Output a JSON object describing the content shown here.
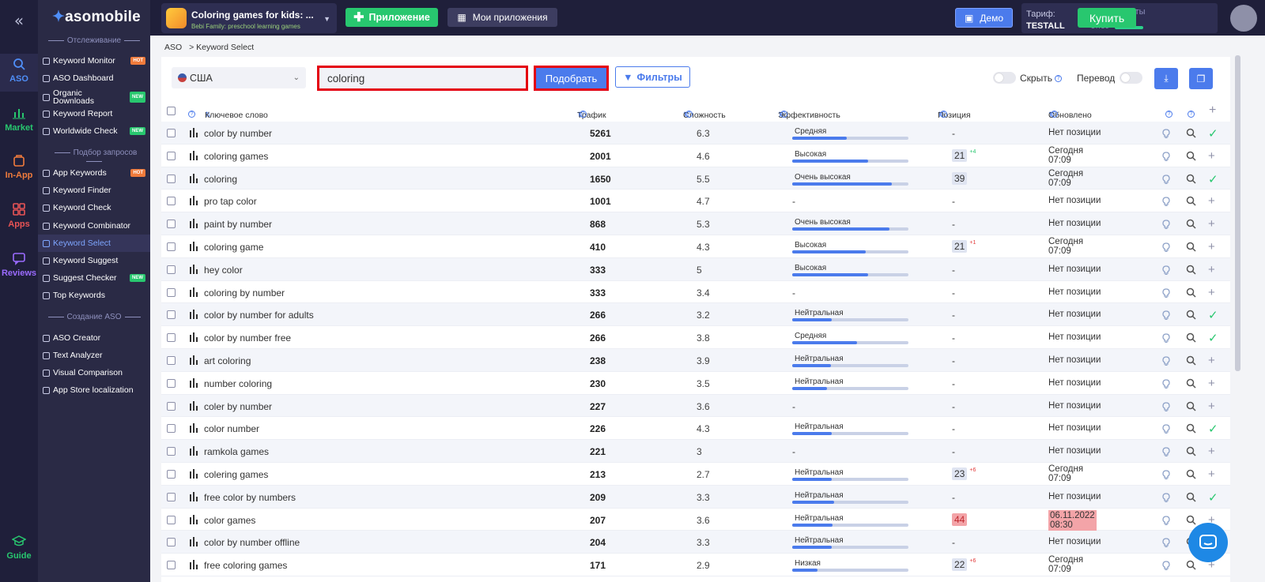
{
  "rail": {
    "items": [
      {
        "label": "ASO",
        "color": "#4f8ef7"
      },
      {
        "label": "Market",
        "color": "#28c76f"
      },
      {
        "label": "In-App",
        "color": "#f07b3c"
      },
      {
        "label": "Apps",
        "color": "#ea5455"
      },
      {
        "label": "Reviews",
        "color": "#9b6bff"
      }
    ],
    "guide": "Guide"
  },
  "brand": {
    "name": "asomobile"
  },
  "sidebar": {
    "sections": [
      "Отслеживание",
      "Подбор запросов",
      "Создание ASO"
    ],
    "items": [
      {
        "label": "Keyword Monitor",
        "tag": "HOT"
      },
      {
        "label": "ASO Dashboard",
        "tag": ""
      },
      {
        "label": "Organic Downloads",
        "tag": "NEW"
      },
      {
        "label": "Keyword Report",
        "tag": ""
      },
      {
        "label": "Worldwide Check",
        "tag": "NEW"
      },
      {
        "label": "App Keywords",
        "tag": "HOT"
      },
      {
        "label": "Keyword Finder",
        "tag": ""
      },
      {
        "label": "Keyword Check",
        "tag": ""
      },
      {
        "label": "Keyword Combinator",
        "tag": ""
      },
      {
        "label": "Keyword Select",
        "tag": ""
      },
      {
        "label": "Keyword Suggest",
        "tag": ""
      },
      {
        "label": "Suggest Checker",
        "tag": "NEW"
      },
      {
        "label": "Top Keywords",
        "tag": ""
      },
      {
        "label": "ASO Creator",
        "tag": ""
      },
      {
        "label": "Text Analyzer",
        "tag": ""
      },
      {
        "label": "Visual Comparison",
        "tag": ""
      },
      {
        "label": "App Store localization",
        "tag": ""
      }
    ]
  },
  "topbar": {
    "app_title": "Coloring games for kids: ...",
    "app_subtitle": "Bebi Family: preschool learning games",
    "add_app": "Приложение",
    "my_apps": "Мои приложения",
    "demo": "Демо",
    "tariff_label": "Тариф:",
    "tariff_name": "TESTALL",
    "tools_label": "Инструменты",
    "tools_count": "57/56",
    "buy": "Купить"
  },
  "breadcrumb": {
    "root": "ASO",
    "current": "> Keyword Select"
  },
  "controls": {
    "country": "США",
    "search_value": "coloring",
    "pick_button": "Подобрать",
    "filters_button": "Фильтры",
    "hide_label": "Скрыть",
    "translate_label": "Перевод"
  },
  "table": {
    "headers": {
      "keyword": "Ключевое слово",
      "traffic": "Трафик",
      "difficulty": "Сложность",
      "efficiency": "Эффективность",
      "position": "Позиция",
      "updated": "Обновлено"
    },
    "rows": [
      {
        "keyword": "color by number",
        "traffic": "5261",
        "difficulty": "6.3",
        "eff_label": "Средняя",
        "eff_level": 0.47,
        "position": "-",
        "pos_change": "",
        "pos_dir": "",
        "pos_red": false,
        "updated": [
          "Нет позиции"
        ],
        "upd_red": false,
        "last": "check"
      },
      {
        "keyword": "coloring games",
        "traffic": "2001",
        "difficulty": "4.6",
        "eff_label": "Высокая",
        "eff_level": 0.65,
        "position": "21",
        "pos_change": "+4",
        "pos_dir": "up",
        "pos_red": false,
        "updated": [
          "Сегодня",
          "07:09"
        ],
        "upd_red": false,
        "last": "plus"
      },
      {
        "keyword": "coloring",
        "traffic": "1650",
        "difficulty": "5.5",
        "eff_label": "Очень высокая",
        "eff_level": 0.86,
        "position": "39",
        "pos_change": "",
        "pos_dir": "",
        "pos_red": false,
        "updated": [
          "Сегодня",
          "07:09"
        ],
        "upd_red": false,
        "last": "check"
      },
      {
        "keyword": "pro tap color",
        "traffic": "1001",
        "difficulty": "4.7",
        "eff_label": "-",
        "eff_level": null,
        "position": "-",
        "pos_change": "",
        "pos_dir": "",
        "pos_red": false,
        "updated": [
          "Нет позиции"
        ],
        "upd_red": false,
        "last": "plus"
      },
      {
        "keyword": "paint by number",
        "traffic": "868",
        "difficulty": "5.3",
        "eff_label": "Очень высокая",
        "eff_level": 0.84,
        "position": "-",
        "pos_change": "",
        "pos_dir": "",
        "pos_red": false,
        "updated": [
          "Нет позиции"
        ],
        "upd_red": false,
        "last": "plus"
      },
      {
        "keyword": "coloring game",
        "traffic": "410",
        "difficulty": "4.3",
        "eff_label": "Высокая",
        "eff_level": 0.63,
        "position": "21",
        "pos_change": "+1",
        "pos_dir": "down",
        "pos_red": false,
        "updated": [
          "Сегодня",
          "07:09"
        ],
        "upd_red": false,
        "last": "plus"
      },
      {
        "keyword": "hey color",
        "traffic": "333",
        "difficulty": "5",
        "eff_label": "Высокая",
        "eff_level": 0.65,
        "position": "-",
        "pos_change": "",
        "pos_dir": "",
        "pos_red": false,
        "updated": [
          "Нет позиции"
        ],
        "upd_red": false,
        "last": "plus"
      },
      {
        "keyword": "coloring by number",
        "traffic": "333",
        "difficulty": "3.4",
        "eff_label": "-",
        "eff_level": null,
        "position": "-",
        "pos_change": "",
        "pos_dir": "",
        "pos_red": false,
        "updated": [
          "Нет позиции"
        ],
        "upd_red": false,
        "last": "plus"
      },
      {
        "keyword": "color by number for adults",
        "traffic": "266",
        "difficulty": "3.2",
        "eff_label": "Нейтральная",
        "eff_level": 0.34,
        "position": "-",
        "pos_change": "",
        "pos_dir": "",
        "pos_red": false,
        "updated": [
          "Нет позиции"
        ],
        "upd_red": false,
        "last": "check"
      },
      {
        "keyword": "color by number free",
        "traffic": "266",
        "difficulty": "3.8",
        "eff_label": "Средняя",
        "eff_level": 0.56,
        "position": "-",
        "pos_change": "",
        "pos_dir": "",
        "pos_red": false,
        "updated": [
          "Нет позиции"
        ],
        "upd_red": false,
        "last": "check"
      },
      {
        "keyword": "art coloring",
        "traffic": "238",
        "difficulty": "3.9",
        "eff_label": "Нейтральная",
        "eff_level": 0.33,
        "position": "-",
        "pos_change": "",
        "pos_dir": "",
        "pos_red": false,
        "updated": [
          "Нет позиции"
        ],
        "upd_red": false,
        "last": "plus"
      },
      {
        "keyword": "number coloring",
        "traffic": "230",
        "difficulty": "3.5",
        "eff_label": "Нейтральная",
        "eff_level": 0.3,
        "position": "-",
        "pos_change": "",
        "pos_dir": "",
        "pos_red": false,
        "updated": [
          "Нет позиции"
        ],
        "upd_red": false,
        "last": "plus"
      },
      {
        "keyword": "coler by number",
        "traffic": "227",
        "difficulty": "3.6",
        "eff_label": "-",
        "eff_level": null,
        "position": "-",
        "pos_change": "",
        "pos_dir": "",
        "pos_red": false,
        "updated": [
          "Нет позиции"
        ],
        "upd_red": false,
        "last": "plus"
      },
      {
        "keyword": "color number",
        "traffic": "226",
        "difficulty": "4.3",
        "eff_label": "Нейтральная",
        "eff_level": 0.34,
        "position": "-",
        "pos_change": "",
        "pos_dir": "",
        "pos_red": false,
        "updated": [
          "Нет позиции"
        ],
        "upd_red": false,
        "last": "check"
      },
      {
        "keyword": "ramkola games",
        "traffic": "221",
        "difficulty": "3",
        "eff_label": "-",
        "eff_level": null,
        "position": "-",
        "pos_change": "",
        "pos_dir": "",
        "pos_red": false,
        "updated": [
          "Нет позиции"
        ],
        "upd_red": false,
        "last": "plus"
      },
      {
        "keyword": "colering games",
        "traffic": "213",
        "difficulty": "2.7",
        "eff_label": "Нейтральная",
        "eff_level": 0.34,
        "position": "23",
        "pos_change": "+6",
        "pos_dir": "down",
        "pos_red": false,
        "updated": [
          "Сегодня",
          "07:09"
        ],
        "upd_red": false,
        "last": "plus"
      },
      {
        "keyword": "free color by numbers",
        "traffic": "209",
        "difficulty": "3.3",
        "eff_label": "Нейтральная",
        "eff_level": 0.36,
        "position": "-",
        "pos_change": "",
        "pos_dir": "",
        "pos_red": false,
        "updated": [
          "Нет позиции"
        ],
        "upd_red": false,
        "last": "check"
      },
      {
        "keyword": "color games",
        "traffic": "207",
        "difficulty": "3.6",
        "eff_label": "Нейтральная",
        "eff_level": 0.35,
        "position": "44",
        "pos_change": "",
        "pos_dir": "",
        "pos_red": true,
        "updated": [
          "06.11.2022",
          "08:30"
        ],
        "upd_red": true,
        "last": "plus"
      },
      {
        "keyword": "color by number offline",
        "traffic": "204",
        "difficulty": "3.3",
        "eff_label": "Нейтральная",
        "eff_level": 0.34,
        "position": "-",
        "pos_change": "",
        "pos_dir": "",
        "pos_red": false,
        "updated": [
          "Нет позиции"
        ],
        "upd_red": false,
        "last": "plus"
      },
      {
        "keyword": "free coloring games",
        "traffic": "171",
        "difficulty": "2.9",
        "eff_label": "Низкая",
        "eff_level": 0.22,
        "position": "22",
        "pos_change": "+6",
        "pos_dir": "down",
        "pos_red": false,
        "updated": [
          "Сегодня",
          "07:09"
        ],
        "upd_red": false,
        "last": "plus"
      }
    ]
  },
  "colors": {
    "accent": "#4b7bec",
    "success": "#28c76f",
    "danger": "#e4000f"
  }
}
